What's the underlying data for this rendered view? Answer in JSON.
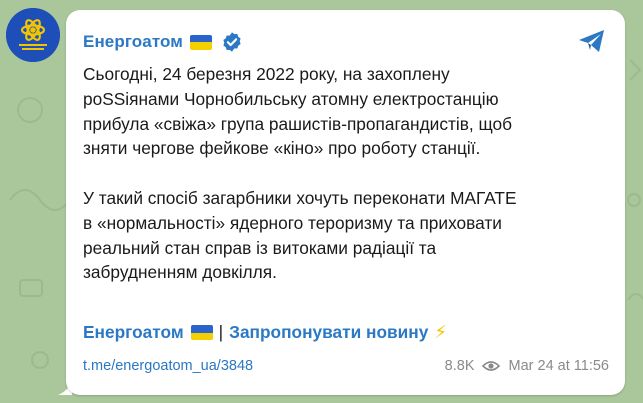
{
  "channel": {
    "name": "Енергоатом",
    "verified": true,
    "avatar_colors": {
      "background": "#1e4fb8",
      "accent": "#f2c500"
    }
  },
  "message": {
    "paragraphs": [
      "Сьогодні, 24 березня 2022 року, на захоплену\npoSSіянами Чорнобильську атомну електростанцію\nприбула «свіжа» група рашистів-пропагандистів, щоб\nзняти чергове фейкове «кіно» про роботу станції.",
      "У такий спосіб загарбники хочуть переконати МАГАТЕ\nв «нормальності» ядерного тероризму та приховати\nреальний стан справ із витоками радіації та\nзабрудненням довкілля."
    ]
  },
  "footer": {
    "channel_link": "Енергоатом",
    "separator": "|",
    "suggest_link": "Запропонувати новину",
    "bolt": "⚡"
  },
  "meta": {
    "post_url": "t.me/energoatom_ua/3848",
    "views": "8.8K",
    "date": "Mar 24 at 11:56"
  },
  "icons": {
    "share": "telegram-share-icon",
    "views": "eye-icon",
    "verified": "verified-badge-icon",
    "flag": "ukraine-flag-icon"
  },
  "colors": {
    "link": "#2b78c4",
    "text": "#1a1a1a",
    "muted": "#8a8a8a",
    "flag_blue": "#2a63c9",
    "flag_yellow": "#f5d000",
    "wallpaper": "#a9c79b"
  }
}
